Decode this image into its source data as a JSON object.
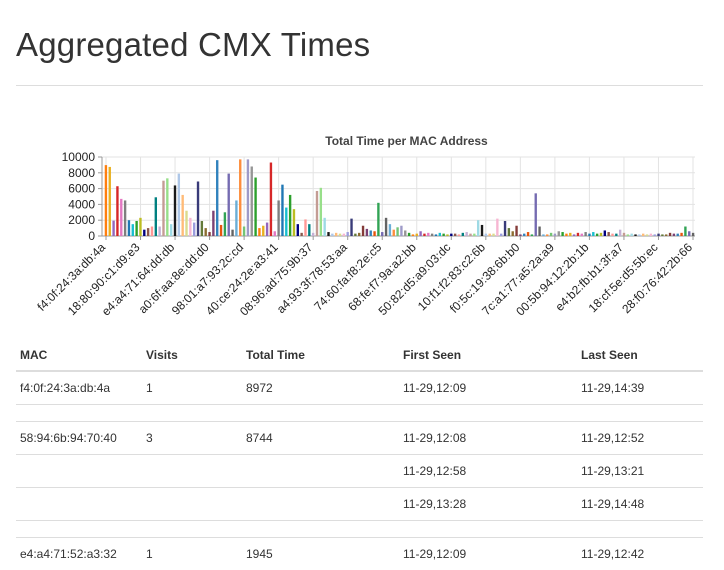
{
  "page": {
    "title": "Aggregated CMX Times"
  },
  "chart_data": {
    "type": "bar",
    "title": "Total Time per MAC Address",
    "xlabel": "",
    "ylabel": "",
    "ylim": [
      0,
      10000
    ],
    "yticks": [
      0,
      2000,
      4000,
      6000,
      8000,
      10000
    ],
    "grid": true,
    "legend": "none",
    "tick_labels": [
      "f4:0f:24:3a:db:4a",
      "18:80:90:c1:d9:e3",
      "e4:a4:71:64:dd:db",
      "a0:6f:aa:8e:dd:d0",
      "98:01:a7:93:2c:cd",
      "40:ce:24:2e:a3:41",
      "08:96:ad:75:9b:37",
      "a4:93:3f:78:53:aa",
      "74:60:fa:f8:2e:c5",
      "68:fe:f7:9a:a2:bb",
      "50:82:d5:a9:03:dc",
      "10:f1:f2:83:c2:6b",
      "f0:5c:19:38:6b:b0",
      "7c:a1:77:a5:2a:a9",
      "00:5b:94:12:2b:1b",
      "e4:b2:fb:b1:3f:a7",
      "18:cf:5e:d5:5b:ec",
      "28:f0:76:42:2b:66"
    ],
    "values": [
      8972,
      8744,
      1945,
      6300,
      4700,
      4500,
      2000,
      1500,
      1900,
      2300,
      800,
      1000,
      1200,
      4900,
      1200,
      7000,
      7300,
      1500,
      6400,
      7900,
      5200,
      3200,
      2300,
      1700,
      6900,
      1900,
      1000,
      500,
      3200,
      9600,
      1400,
      3000,
      7900,
      800,
      4500,
      9700,
      1200,
      9700,
      8800,
      7400,
      1000,
      1300,
      1700,
      9300,
      600,
      4500,
      6500,
      3600,
      5200,
      3400,
      1500,
      400,
      2100,
      1500,
      400,
      5700,
      6100,
      2300,
      500,
      300,
      400,
      300,
      300,
      500,
      2200,
      300,
      400,
      1300,
      900,
      700,
      600,
      4200,
      500,
      2300,
      1500,
      800,
      1100,
      1300,
      700,
      400,
      200,
      300,
      600,
      300,
      400,
      300,
      200,
      400,
      300,
      200,
      300,
      300,
      200,
      400,
      500,
      300,
      300,
      2000,
      1400,
      300,
      300,
      300,
      2200,
      300,
      1900,
      1000,
      600,
      1300,
      200,
      300,
      500,
      200,
      5400,
      1200,
      200,
      200,
      400,
      300,
      600,
      500,
      300,
      400,
      200,
      400,
      300,
      500,
      300,
      500,
      300,
      400,
      700,
      500,
      300,
      300,
      800,
      400,
      200,
      300,
      200,
      200,
      300,
      200,
      300,
      200,
      300,
      200,
      200,
      400,
      300,
      300,
      400,
      1200,
      600,
      400
    ],
    "colors": [
      "#ff7f0e",
      "#e8b020",
      "#9467bd",
      "#d62728",
      "#e377c2",
      "#7f7f7f",
      "#1f77b4",
      "#17becf",
      "#2ca02c",
      "#bcbd22",
      "#000080",
      "#8c564b",
      "#ff9896",
      "#008080",
      "#c5b0d5",
      "#c49c94",
      "#98df8a",
      "#9edae5",
      "#1a1a1a",
      "#aec7e8",
      "#ffbb78",
      "#dbdb8d",
      "#f7b6d2",
      "#9c9ede",
      "#393b79",
      "#637939",
      "#8c6d31",
      "#843c39",
      "#7b4173",
      "#3182bd",
      "#e6550d",
      "#31a354",
      "#756bb1",
      "#636363",
      "#6baed6",
      "#fd8d3c",
      "#74c476",
      "#9e9ac8",
      "#969696",
      "#2ca02c"
    ]
  },
  "table": {
    "columns": [
      "MAC",
      "Visits",
      "Total Time",
      "First Seen",
      "Last Seen"
    ],
    "rows": [
      {
        "mac": "f4:0f:24:3a:db:4a",
        "visits": "1",
        "total": "8972",
        "first": "11-29,12:09",
        "last": "11-29,14:39"
      },
      {
        "mac": "58:94:6b:94:70:40",
        "visits": "3",
        "total": "8744",
        "first": "11-29,12:08",
        "last": "11-29,12:52"
      },
      {
        "mac": "",
        "visits": "",
        "total": "",
        "first": "11-29,12:58",
        "last": "11-29,13:21"
      },
      {
        "mac": "",
        "visits": "",
        "total": "",
        "first": "11-29,13:28",
        "last": "11-29,14:48"
      },
      {
        "mac": "e4:a4:71:52:a3:32",
        "visits": "1",
        "total": "1945",
        "first": "11-29,12:09",
        "last": "11-29,12:42"
      }
    ]
  }
}
